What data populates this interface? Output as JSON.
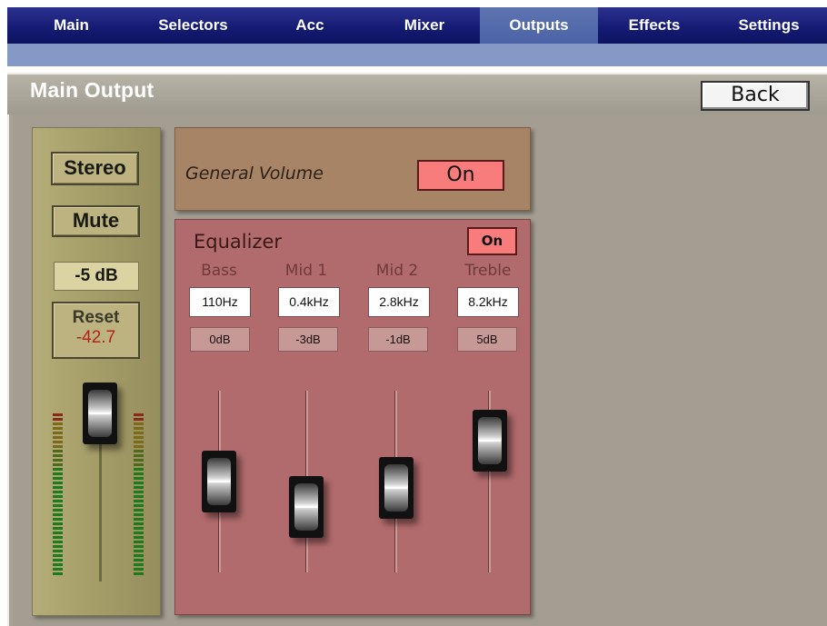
{
  "nav": {
    "tabs": [
      {
        "label": "Main"
      },
      {
        "label": "Selectors"
      },
      {
        "label": "Acc"
      },
      {
        "label": "Mixer"
      },
      {
        "label": "Outputs",
        "active": true
      },
      {
        "label": "Effects"
      },
      {
        "label": "Settings"
      }
    ]
  },
  "page": {
    "title": "Main Output",
    "back_label": "Back"
  },
  "master": {
    "stereo_label": "Stereo",
    "mute_label": "Mute",
    "level": "-5 dB",
    "reset_label": "Reset",
    "reset_value": "-42.7"
  },
  "general_volume": {
    "label": "General Volume",
    "toggle": "On"
  },
  "equalizer": {
    "title": "Equalizer",
    "toggle": "On",
    "bands": [
      {
        "name": "Bass",
        "freq": "110Hz",
        "gain": "0dB"
      },
      {
        "name": "Mid 1",
        "freq": "0.4kHz",
        "gain": "-3dB"
      },
      {
        "name": "Mid 2",
        "freq": "2.8kHz",
        "gain": "-1dB"
      },
      {
        "name": "Treble",
        "freq": "8.2kHz",
        "gain": "5dB"
      }
    ]
  },
  "colors": {
    "accent_on": "#f97c7c",
    "nav_bg": "#131a72",
    "strip_bg": "#a49d68",
    "eq_bg": "#b26b6d",
    "gv_bg": "#a78466"
  }
}
